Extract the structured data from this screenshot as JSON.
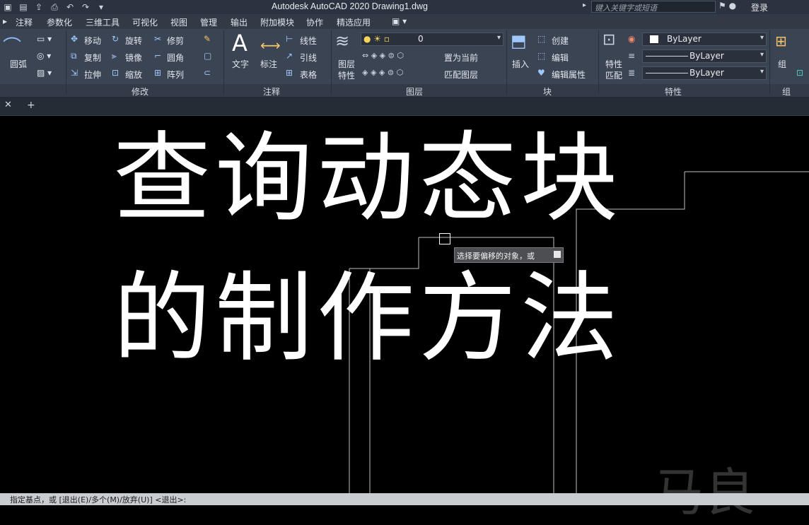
{
  "window": {
    "title": "Autodesk AutoCAD 2020    Drawing1.dwg",
    "search_placeholder": "键入关键字或短语",
    "login": "登录"
  },
  "menu": [
    "注释",
    "参数化",
    "三维工具",
    "可视化",
    "视图",
    "管理",
    "输出",
    "附加模块",
    "协作",
    "精选应用"
  ],
  "ribbon": {
    "draw": {
      "arc": "圆弧"
    },
    "modify": {
      "title": "修改",
      "move": "移动",
      "rotate": "旋转",
      "trim": "修剪",
      "copy": "复制",
      "mirror": "镜像",
      "fillet": "圆角",
      "stretch": "拉伸",
      "scale": "缩放",
      "array": "阵列"
    },
    "annotation": {
      "title": "注释",
      "text": "文字",
      "dimension": "标注",
      "linear": "线性",
      "leader": "引线",
      "table": "表格"
    },
    "layers": {
      "title": "图层",
      "properties_line1": "图层",
      "properties_line2": "特性",
      "current_layer": "0",
      "set_current": "置为当前",
      "match_layer": "匹配图层"
    },
    "block": {
      "title": "块",
      "insert": "插入",
      "create": "创建",
      "edit": "编辑",
      "edit_attributes": "编辑属性"
    },
    "properties": {
      "title": "特性",
      "match_line1": "特性",
      "match_line2": "匹配",
      "color": "ByLayer",
      "linetype": "ByLayer",
      "lineweight": "ByLayer"
    },
    "group": {
      "title": "组",
      "label": "组"
    }
  },
  "canvas": {
    "overlay_line1": "查询动态块",
    "overlay_line2": "的制作方法",
    "tooltip": "选择要偏移的对象，或",
    "watermark": "马良"
  },
  "command_line": "指定基点，或 [退出(E)/多个(M)/放弃(U)] <退出>:"
}
